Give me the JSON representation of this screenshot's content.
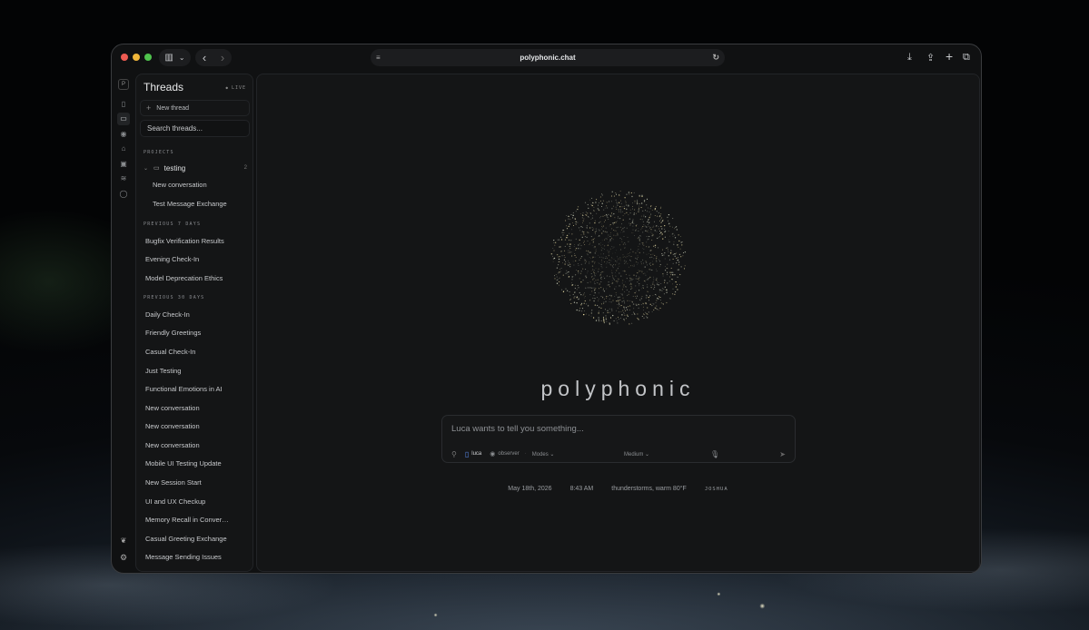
{
  "browser": {
    "url": "polyphonic.chat",
    "sidebar_toggle_icon": "▥",
    "dropdown_icon": "⌄",
    "back_icon": "‹",
    "forward_icon": "›",
    "reload_icon": "↻",
    "page_icon": "≡",
    "download_icon": "⤓",
    "share_icon": "⇪",
    "new_tab_icon": "+",
    "tabs_icon": "⧉"
  },
  "rail": {
    "logo": "P",
    "icons": [
      "▯",
      "▭",
      "◉",
      "⌂",
      "▣",
      "≋",
      "◯"
    ],
    "bottom_icons": [
      "❦",
      "⚙"
    ]
  },
  "threads": {
    "title": "Threads",
    "live": "LIVE",
    "new_thread": "New thread",
    "search_placeholder": "Search threads...",
    "projects_label": "PROJECTS",
    "project": {
      "name": "testing",
      "count": "2"
    },
    "project_items": [
      "New conversation",
      "Test Message Exchange"
    ],
    "prev7_label": "PREVIOUS 7 DAYS",
    "prev7_items": [
      "Bugfix Verification Results",
      "Evening Check-In",
      "Model Deprecation Ethics"
    ],
    "prev30_label": "PREVIOUS 30 DAYS",
    "prev30_items": [
      "Daily Check-In",
      "Friendly Greetings",
      "Casual Check-In",
      "Just Testing",
      "Functional Emotions in AI",
      "New conversation",
      "New conversation",
      "New conversation",
      "Mobile UI Testing Update",
      "New Session Start",
      "UI and UX Checkup",
      "Memory Recall in Conversation",
      "Casual Greeting Exchange",
      "Message Sending Issues"
    ]
  },
  "main": {
    "brand": "polyphonic",
    "composer": {
      "placeholder": "Luca wants to tell you something...",
      "persona": "luca",
      "observer": "observer",
      "modes": "Modes ⌄",
      "effort": "Medium ⌄"
    },
    "status": {
      "date": "May 18th, 2026",
      "time": "8:43 AM",
      "weather": "thunderstorms, warm 80°F",
      "user": "JOSHUA"
    }
  }
}
